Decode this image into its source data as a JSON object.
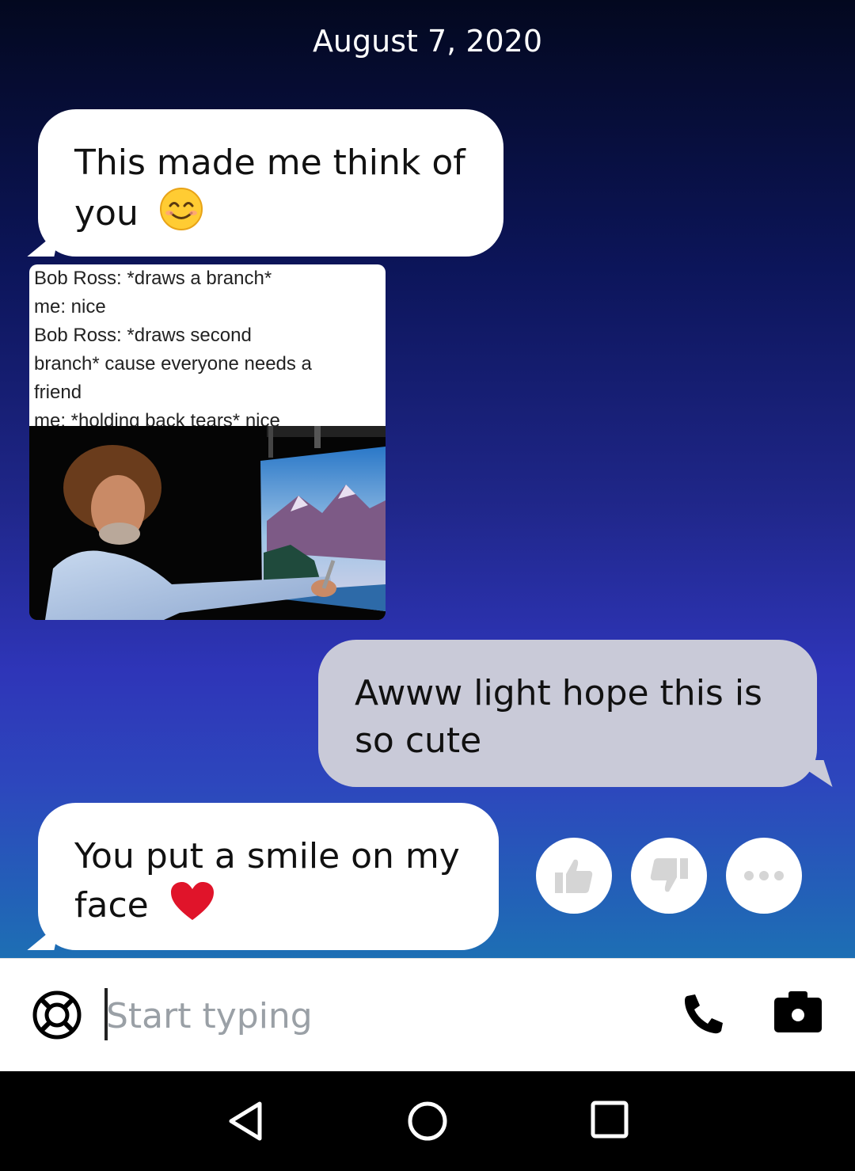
{
  "conversation": {
    "date_header": "August 7, 2020",
    "messages": [
      {
        "direction": "incoming",
        "text": "This made me think of you",
        "emoji": "smiling-face-emoji"
      },
      {
        "direction": "incoming",
        "type": "image",
        "meme_caption_lines": [
          "Bob Ross: *draws a branch*",
          "me: nice",
          "Bob Ross: *draws second",
          "branch* cause everyone needs a",
          "friend",
          "me: *holding back tears* nice"
        ]
      },
      {
        "direction": "outgoing",
        "text": "Awww light hope this is so cute"
      },
      {
        "direction": "incoming",
        "text": "You put a smile on my face",
        "emoji": "red-heart-emoji"
      }
    ]
  },
  "reactions": [
    "thumbs-up-icon",
    "thumbs-down-icon",
    "more-options-icon"
  ],
  "composer": {
    "placeholder": "Start typing",
    "icons": [
      "help-lifebuoy-icon",
      "phone-call-icon",
      "camera-icon"
    ]
  },
  "system_nav": [
    "back-icon",
    "home-icon",
    "recents-icon"
  ],
  "colors": {
    "incoming_bubble": "#ffffff",
    "outgoing_bubble": "#c9cad8",
    "background_top": "#03081f",
    "background_bottom": "#1d6fb4"
  }
}
